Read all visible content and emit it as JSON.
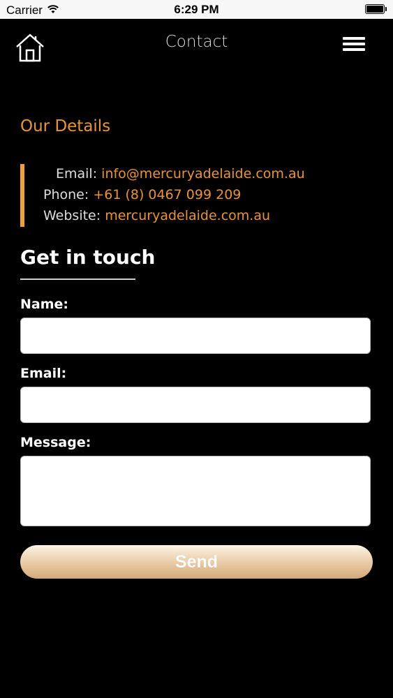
{
  "status_bar": {
    "carrier": "Carrier",
    "time": "6:29 PM"
  },
  "nav": {
    "title": "Contact",
    "left_icon": "home-icon",
    "right_icon": "hamburger-menu-icon"
  },
  "details": {
    "title": "Our Details",
    "email_label": "Email:",
    "email_value": "info@mercuryadelaide.com.au",
    "phone_label": "Phone:",
    "phone_value": "+61 (8) 0467 099 209",
    "website_label": "Website:",
    "website_value": "mercuryadelaide.com.au"
  },
  "form": {
    "title": "Get in touch",
    "name_label": "Name:",
    "name_value": "",
    "email_label": "Email:",
    "email_value": "",
    "message_label": "Message:",
    "message_value": "",
    "send_label": "Send"
  },
  "colors": {
    "accent": "#e8943a",
    "accent_bar": "#f0a23a",
    "background": "#000000"
  }
}
